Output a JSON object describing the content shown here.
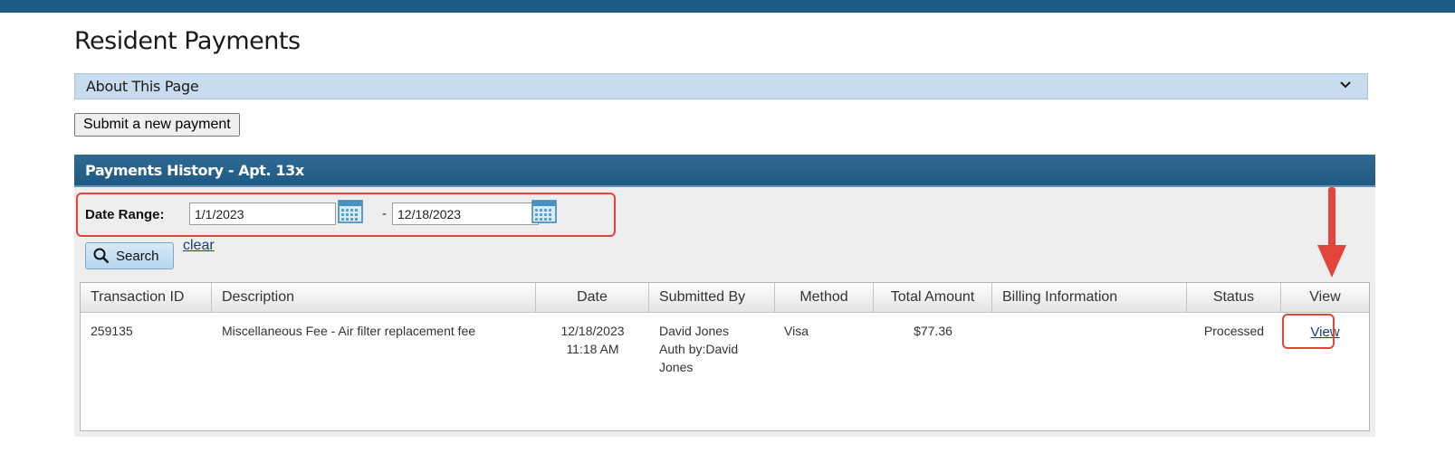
{
  "page_title": "Resident Payments",
  "about": {
    "label": "About This Page"
  },
  "actions": {
    "submit_label": "Submit a new payment"
  },
  "history": {
    "title": "Payments History - Apt. 13x",
    "date_range": {
      "label": "Date Range:",
      "start": "1/1/2023",
      "separator": "-",
      "end": "12/18/2023"
    },
    "search_label": "Search",
    "clear_label": "clear",
    "columns": [
      "Transaction ID",
      "Description",
      "Date",
      "Submitted By",
      "Method",
      "Total Amount",
      "Billing Information",
      "Status",
      "View"
    ],
    "rows": [
      {
        "transaction_id": "259135",
        "description": "Miscellaneous Fee - Air filter replacement fee",
        "date": "12/18/2023",
        "time": "11:18 AM",
        "submitted_by": "David Jones",
        "auth_line1": "Auth by:David",
        "auth_line2": "Jones",
        "method": "Visa",
        "total_amount": "$77.36",
        "billing_information": "",
        "status": "Processed",
        "view_label": "View"
      }
    ]
  },
  "colors": {
    "header": "#1f5a84",
    "about_bar": "#c8dcee",
    "highlight": "#e2453d",
    "link": "#1a3c7a"
  },
  "icons": [
    "chevron-down-icon",
    "calendar-icon",
    "search-icon",
    "arrow-down-icon"
  ]
}
